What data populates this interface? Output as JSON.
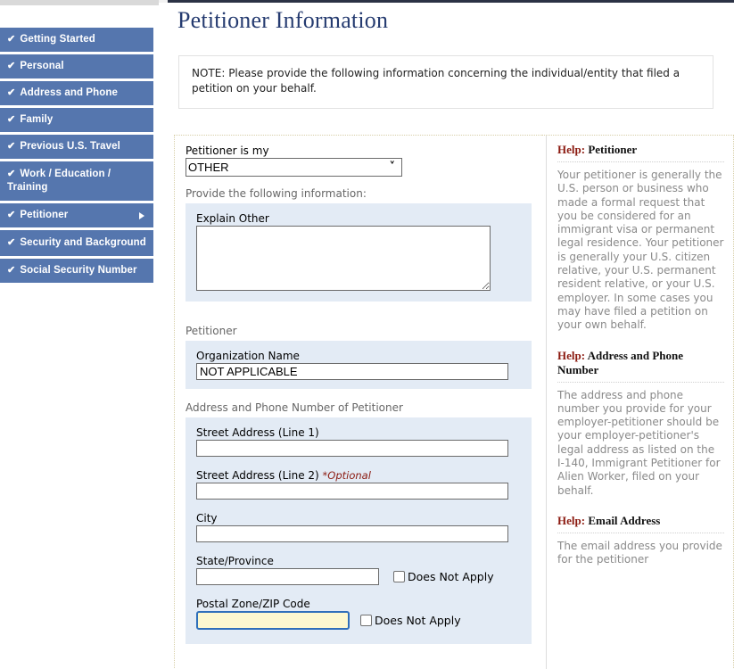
{
  "window": {
    "title": "Petitioner Information"
  },
  "sidebar": {
    "items": [
      {
        "label": "Getting Started",
        "check": "✔",
        "arrow": false
      },
      {
        "label": "Personal",
        "check": "✔",
        "arrow": false
      },
      {
        "label": "Address and Phone",
        "check": "✔",
        "arrow": false
      },
      {
        "label": "Family",
        "check": "✔",
        "arrow": false
      },
      {
        "label": "Previous U.S. Travel",
        "check": "✔",
        "arrow": false
      },
      {
        "label": "Work / Education / Training",
        "check": "✔",
        "arrow": false
      },
      {
        "label": "Petitioner",
        "check": "✔",
        "arrow": true
      },
      {
        "label": "Security and Background",
        "check": "✔",
        "arrow": false
      },
      {
        "label": "Social Security Number",
        "check": "✔",
        "arrow": false
      }
    ]
  },
  "note": {
    "text": "NOTE: Please provide the following information concerning the individual/entity that filed a petition on your behalf."
  },
  "form": {
    "petitioner_is_my": {
      "label": "Petitioner is my",
      "value": "OTHER",
      "options": [
        "OTHER"
      ],
      "chevron": "˅"
    },
    "provide_info_label": "Provide the following information:",
    "explain_other": {
      "label": "Explain Other",
      "value": "",
      "placeholder": ""
    },
    "petitioner_group_label": "Petitioner",
    "organization_name": {
      "label": "Organization Name",
      "value": "NOT APPLICABLE",
      "placeholder": ""
    },
    "address_group_label": "Address and Phone Number of Petitioner",
    "street1": {
      "label": "Street Address (Line 1)",
      "value": "",
      "placeholder": ""
    },
    "street2": {
      "label": "Street Address (Line 2)",
      "optional_tag": "*Optional",
      "value": "",
      "placeholder": ""
    },
    "city": {
      "label": "City",
      "value": "",
      "placeholder": ""
    },
    "state_province": {
      "label": "State/Province",
      "value": "",
      "placeholder": "",
      "does_not_apply": "Does Not Apply",
      "checked": false
    },
    "postal_zip": {
      "label": "Postal Zone/ZIP Code",
      "value": "",
      "placeholder": "",
      "does_not_apply": "Does Not Apply",
      "checked": false,
      "focused": true
    }
  },
  "help": {
    "sections": [
      {
        "head_word": "Help:",
        "head_topic": "Petitioner",
        "body": "Your petitioner is generally the U.S. person or business who made a formal request that you be considered for an immigrant visa or permanent legal residence. Your petitioner is generally your U.S. citizen relative, your U.S. permanent resident relative, or your U.S. employer. In some cases you may have filed a petition on your own behalf."
      },
      {
        "head_word": "Help:",
        "head_topic": "Address and Phone Number",
        "body": "The address and phone number you provide for your employer-petitioner should be your employer-petitioner's legal address as listed on the I-140, Immigrant Petitioner for Alien Worker, filed on your behalf."
      },
      {
        "head_word": "Help:",
        "head_topic": "Email Address",
        "body": "The email address you provide for the petitioner"
      }
    ]
  },
  "colors": {
    "nav_blue": "#5576ae",
    "title_navy": "#253b70",
    "shaded_panel": "#e3ebf5",
    "help_red": "#8b1a10",
    "focus_yellow": "#fcf8d0",
    "focus_blue": "#2f6fba",
    "optional_red": "#8b1a10"
  }
}
